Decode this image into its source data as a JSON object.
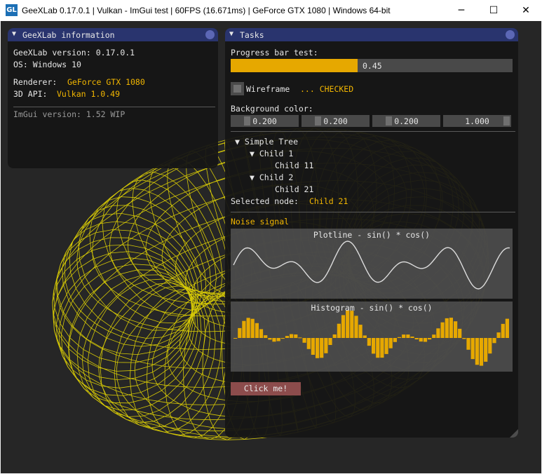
{
  "titlebar": {
    "icon_text": "GL",
    "title": "GeeXLab 0.17.0.1 | Vulkan - ImGui test | 60FPS (16.671ms) | GeForce GTX 1080 | Windows 64-bit",
    "minimize": "─",
    "maximize": "☐",
    "close": "✕"
  },
  "info_window": {
    "title": "GeeXLab information",
    "version_label": "GeeXLab version: 0.17.0.1",
    "os_label": "OS: Windows 10",
    "renderer_label": "Renderer:",
    "renderer_value": "GeForce GTX 1080",
    "api_label": "3D API:",
    "api_value": "Vulkan 1.0.49",
    "imgui_label": "ImGui version: 1.52 WIP"
  },
  "tasks_window": {
    "title": "Tasks",
    "progress_label": "Progress bar test:",
    "progress_value": 0.45,
    "progress_text": "0.45",
    "wireframe_label": "Wireframe",
    "wireframe_status": "... CHECKED",
    "bg_color_label": "Background color:",
    "bg_color": [
      "0.200",
      "0.200",
      "0.200",
      "1.000"
    ],
    "bg_color_levels": [
      0.2,
      0.2,
      0.2,
      1.0
    ],
    "tree": {
      "root": "Simple Tree",
      "child1": "Child 1",
      "child11": "Child 11",
      "child2": "Child 2",
      "child21": "Child 21"
    },
    "selected_label": "Selected node:",
    "selected_value": "Child 21",
    "noise_label": "Noise signal",
    "plotline_title": "Plotline - sin() * cos()",
    "histogram_title": "Histogram - sin() * cos()",
    "click_button": "Click me!"
  },
  "colors": {
    "accent": "#e6a800",
    "title_bar": "#29346e",
    "wireframe": "#f5e600",
    "button": "#8c4c4c"
  }
}
